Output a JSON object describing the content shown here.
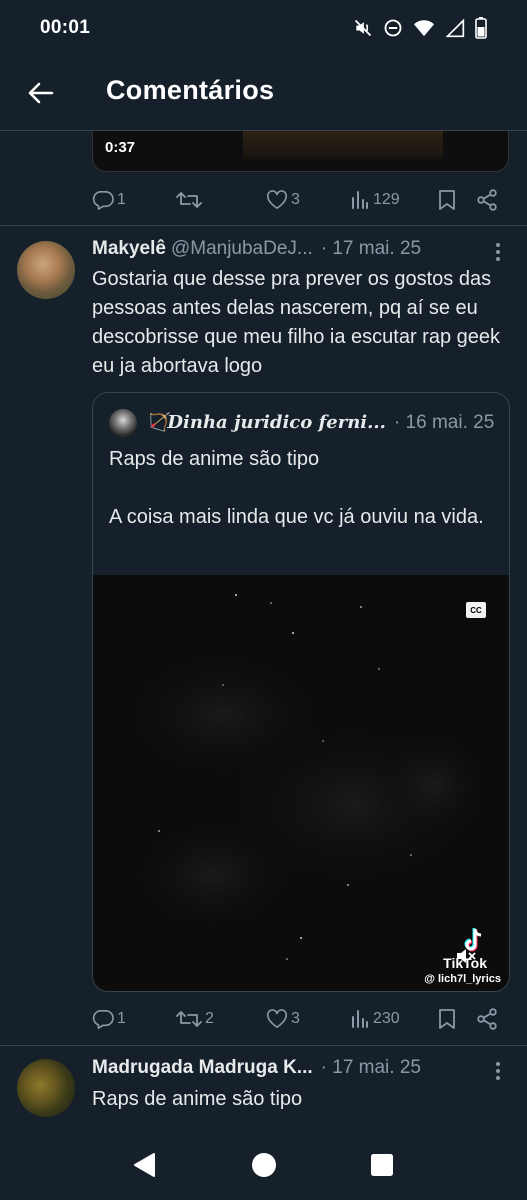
{
  "status_bar": {
    "time": "00:01"
  },
  "header": {
    "title": "Comentários"
  },
  "prev_tweet": {
    "video_duration": "0:37",
    "replies": "1",
    "reposts": "",
    "likes": "3",
    "views": "129"
  },
  "tweet": {
    "name": "Makyelê",
    "handle": "@ManjubaDeJ...",
    "date": "· 17 mai. 25",
    "text": "Gostaria que desse pra prever os gostos das pessoas antes delas nascerem, pq aí se eu descobrisse que meu filho ia escutar rap geek eu ja abortava logo",
    "quote": {
      "name": "🏹𝑫𝒊𝒏𝒉𝒂 𝒋𝒖𝒓𝒊𝒅𝒊𝒄𝒐 𝒇𝒆𝒓𝒏𝒊...",
      "date": "· 16 mai. 25",
      "text_1": "Raps de anime são tipo",
      "text_2": "A coisa mais linda que vc já ouviu na vida.",
      "cc": "CC",
      "tiktok": "TikTok",
      "tiktok_user": "@ lich7l_lyrics"
    },
    "replies": "1",
    "reposts": "2",
    "likes": "3",
    "views": "230"
  },
  "next_tweet": {
    "name": "Madrugada Madruga K...",
    "date": "· 17 mai. 25",
    "text": "Raps de anime são tipo"
  },
  "colors": {
    "background": "#15202b",
    "text": "#e7e9ea",
    "muted": "#8b98a5",
    "border": "#38444d"
  }
}
